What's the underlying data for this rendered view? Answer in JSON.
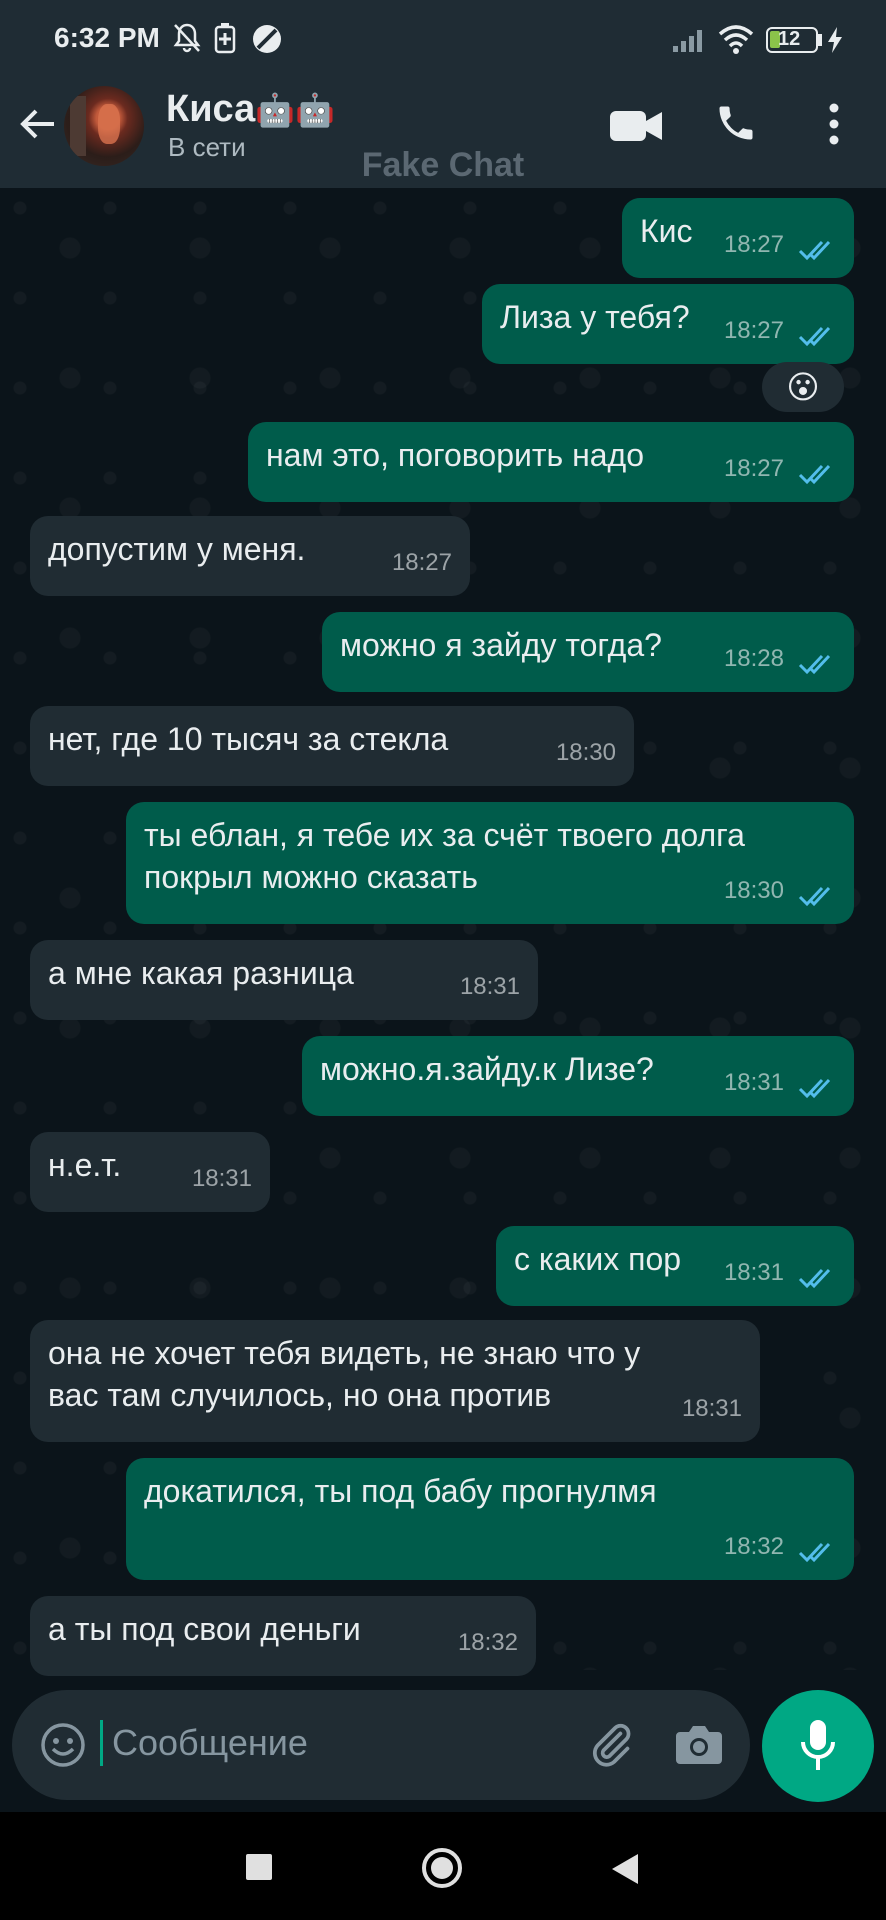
{
  "status_bar": {
    "time": "6:32 PM",
    "battery": "12"
  },
  "header": {
    "name": "Киса",
    "name_emoji": "🤖🤖",
    "status": "В сети",
    "watermark": "Fake Chat"
  },
  "messages": [
    {
      "dir": "out",
      "text": "Кис",
      "time": "18:27"
    },
    {
      "dir": "out",
      "text": "Лиза у тебя?",
      "time": "18:27",
      "reaction": "😮"
    },
    {
      "dir": "out",
      "text": "нам это, поговорить надо",
      "time": "18:27"
    },
    {
      "dir": "in",
      "text": "допустим у меня.",
      "time": "18:27"
    },
    {
      "dir": "out",
      "text": "можно я зайду тогда?",
      "time": "18:28"
    },
    {
      "dir": "in",
      "text": "нет, где 10 тысяч за стекла",
      "time": "18:30"
    },
    {
      "dir": "out",
      "text": "ты еблан, я тебе их за счёт твоего долга\nпокрыл можно сказать",
      "time": "18:30"
    },
    {
      "dir": "in",
      "text": "а мне какая разница",
      "time": "18:31"
    },
    {
      "dir": "out",
      "text": "можно.я.зайду.к Лизе?",
      "time": "18:31"
    },
    {
      "dir": "in",
      "text": "н.е.т.",
      "time": "18:31"
    },
    {
      "dir": "out",
      "text": "с каких пор",
      "time": "18:31"
    },
    {
      "dir": "in",
      "text": "она не хочет тебя видеть, не знаю что у\nвас там случилось, но она против",
      "time": "18:31"
    },
    {
      "dir": "out",
      "text": "докатился, ты под бабу прогнулмя",
      "time": "18:32"
    },
    {
      "dir": "in",
      "text": "а ты под свои деньги",
      "time": "18:32"
    }
  ],
  "input": {
    "placeholder": "Сообщение"
  },
  "colors": {
    "outgoing": "#005c4b",
    "incoming": "#202c33",
    "accent": "#00a884",
    "tick_read": "#53bdeb"
  },
  "icons": [
    "back-arrow-icon",
    "video-call-icon",
    "phone-icon",
    "more-vert-icon",
    "emoji-icon",
    "attach-icon",
    "camera-icon",
    "mic-icon",
    "nav-square-icon",
    "nav-home-icon",
    "nav-back-icon"
  ]
}
